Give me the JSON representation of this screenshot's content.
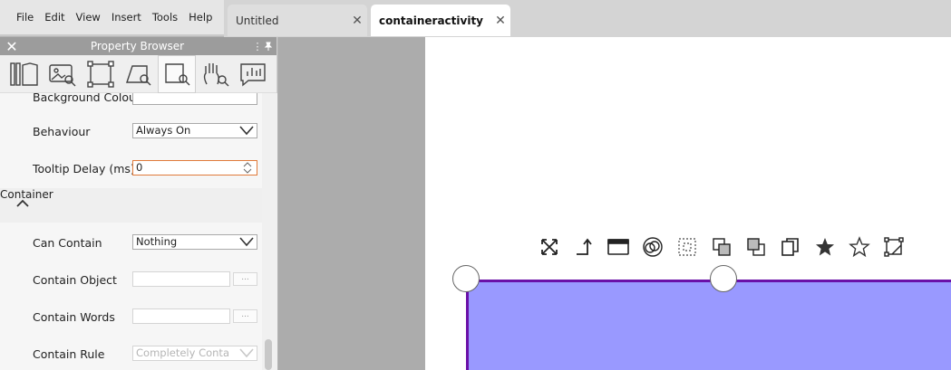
{
  "menu": [
    "File",
    "Edit",
    "View",
    "Insert",
    "Tools",
    "Help"
  ],
  "tabs": [
    {
      "label": "Untitled",
      "close": "✕"
    },
    {
      "label": "containeractivity",
      "close": "✕"
    }
  ],
  "panel": {
    "title": "Property Browser",
    "close_glyph": "✕",
    "menu_glyph": "⋮",
    "pin_glyph": "📌",
    "toolbar_icons": [
      "library-icon",
      "image-search-icon",
      "frame-icon",
      "shape-search-icon",
      "object-search-icon",
      "hand-search-icon",
      "chart-comment-icon"
    ],
    "selected_tool": 4
  },
  "properties": {
    "background_colour": "Background Colour",
    "behaviour": {
      "label": "Behaviour",
      "value": "Always On"
    },
    "tooltip_delay": {
      "label": "Tooltip Delay (ms)",
      "value": "0"
    },
    "container_section": "Container",
    "can_contain": {
      "label": "Can Contain",
      "value": "Nothing"
    },
    "contain_object": {
      "label": "Contain Object",
      "value": "",
      "button": "..."
    },
    "contain_words": {
      "label": "Contain Words",
      "value": "",
      "button": "..."
    },
    "contain_rule": {
      "label": "Contain Rule",
      "value": "Completely Conta"
    }
  },
  "canvas_toolbar": [
    "fit-expand-icon",
    "connect-arrow-icon",
    "window-icon",
    "overlap-circles-icon",
    "focus-frame-icon",
    "layer-back-icon",
    "layer-front-icon",
    "copy-pages-icon",
    "star-filled-icon",
    "star-outline-icon",
    "edit-shape-icon"
  ],
  "colors": {
    "container_fill": "#9999ff",
    "container_border": "#6a10a8",
    "focus_border": "#e07a3a"
  }
}
